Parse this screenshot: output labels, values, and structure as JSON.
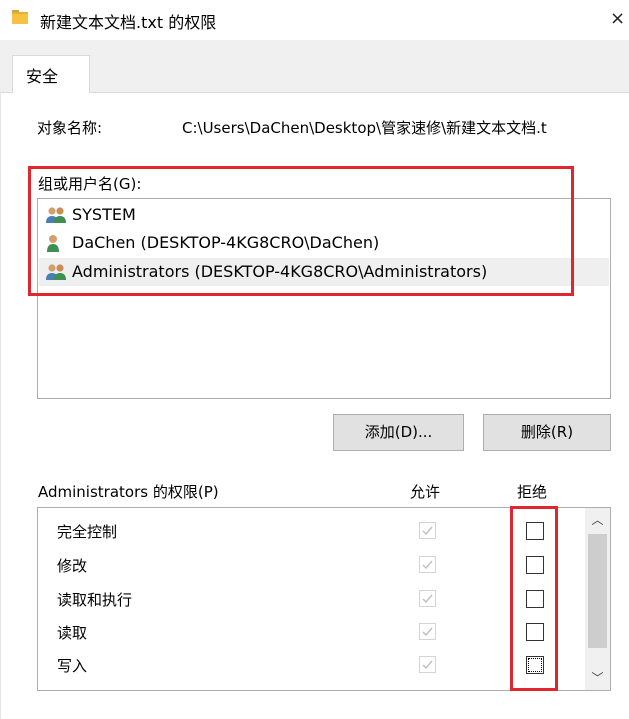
{
  "window": {
    "title": "新建文本文档.txt 的权限",
    "close_glyph": "×"
  },
  "tabs": [
    {
      "label": "安全",
      "active": true
    }
  ],
  "object": {
    "label": "对象名称:",
    "value": "C:\\Users\\DaChen\\Desktop\\管家速修\\新建文本文档.t"
  },
  "groups": {
    "label": "组或用户名(G):",
    "items": [
      {
        "name": "SYSTEM",
        "icon": "user-group-icon",
        "selected": false
      },
      {
        "name": "DaChen (DESKTOP-4KG8CRO\\DaChen)",
        "icon": "user-icon",
        "selected": false
      },
      {
        "name": "Administrators (DESKTOP-4KG8CRO\\Administrators)",
        "icon": "user-group-icon",
        "selected": true
      }
    ]
  },
  "buttons": {
    "add": "添加(D)...",
    "remove": "删除(R)"
  },
  "permissions": {
    "label": "Administrators 的权限(P)",
    "allow_header": "允许",
    "deny_header": "拒绝",
    "items": [
      {
        "name": "完全控制",
        "allow": true,
        "deny": false
      },
      {
        "name": "修改",
        "allow": true,
        "deny": false
      },
      {
        "name": "读取和执行",
        "allow": true,
        "deny": false
      },
      {
        "name": "读取",
        "allow": true,
        "deny": false
      },
      {
        "name": "写入",
        "allow": true,
        "deny": false
      }
    ]
  },
  "colors": {
    "annotation_red": "#e0262e",
    "disabled_check": "#bfbfbf"
  }
}
